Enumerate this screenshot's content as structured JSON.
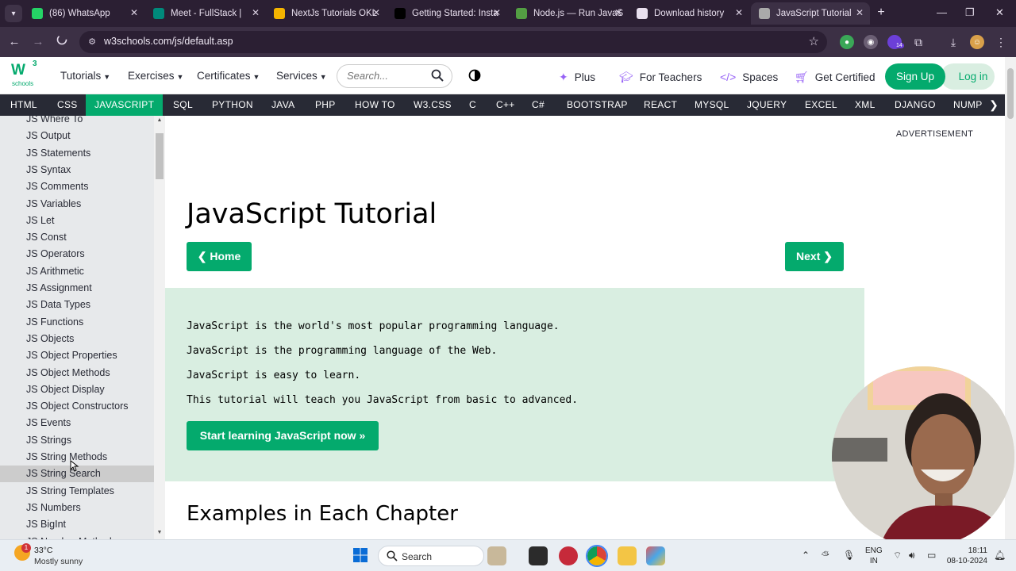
{
  "browser": {
    "tabs": [
      {
        "label": "(86) WhatsApp",
        "icon": "whatsapp-icon",
        "color": "#25d366"
      },
      {
        "label": "Meet - FullStack |",
        "icon": "meet-icon",
        "color": "#00897b"
      },
      {
        "label": "NextJs Tutorials OKL",
        "icon": "slides-icon",
        "color": "#f4b400"
      },
      {
        "label": "Getting Started: Insta",
        "icon": "nextjs-icon",
        "color": "#000000"
      },
      {
        "label": "Node.js — Run JavaS",
        "icon": "nodejs-icon",
        "color": "#539e43"
      },
      {
        "label": "Download history",
        "icon": "download-icon",
        "color": "#e8dfee"
      },
      {
        "label": "JavaScript Tutorial",
        "icon": "loading-icon",
        "color": "#aaaaaa"
      }
    ],
    "url": "w3schools.com/js/default.asp",
    "extension_badge": "14"
  },
  "header": {
    "logo_main": "W",
    "logo_sup": "3",
    "logo_sub": "schools",
    "menus": [
      "Tutorials",
      "Exercises",
      "Certificates",
      "Services"
    ],
    "search_placeholder": "Search...",
    "links": {
      "plus": "Plus",
      "teachers": "For Teachers",
      "spaces": "Spaces",
      "certified": "Get Certified"
    },
    "signup": "Sign Up",
    "login": "Log in"
  },
  "topics": {
    "items": [
      "HTML",
      "CSS",
      "JAVASCRIPT",
      "SQL",
      "PYTHON",
      "JAVA",
      "PHP",
      "HOW TO",
      "W3.CSS",
      "C",
      "C++",
      "C#",
      "BOOTSTRAP",
      "REACT",
      "MYSQL",
      "JQUERY",
      "EXCEL",
      "XML",
      "DJANGO",
      "NUMPY"
    ],
    "active": "JAVASCRIPT"
  },
  "sidebar": {
    "items": [
      "JS Where To",
      "JS Output",
      "JS Statements",
      "JS Syntax",
      "JS Comments",
      "JS Variables",
      "JS Let",
      "JS Const",
      "JS Operators",
      "JS Arithmetic",
      "JS Assignment",
      "JS Data Types",
      "JS Functions",
      "JS Objects",
      "JS Object Properties",
      "JS Object Methods",
      "JS Object Display",
      "JS Object Constructors",
      "JS Events",
      "JS Strings",
      "JS String Methods",
      "JS String Search",
      "JS String Templates",
      "JS Numbers",
      "JS BigInt",
      "JS Number Methods"
    ],
    "hovered": "JS String Search"
  },
  "main": {
    "title": "JavaScript Tutorial",
    "home_button": "❮ Home",
    "next_button": "Next ❯",
    "intro": [
      "JavaScript is the world's most popular programming language.",
      "JavaScript is the programming language of the Web.",
      "JavaScript is easy to learn.",
      "This tutorial will teach you JavaScript from basic to advanced."
    ],
    "start_button": "Start learning JavaScript now »",
    "section_title": "Examples in Each Chapter"
  },
  "ad": {
    "label": "ADVERTISEMENT"
  },
  "taskbar": {
    "temperature": "33°C",
    "condition": "Mostly sunny",
    "weather_badge": "1",
    "search": "Search",
    "lang_top": "ENG",
    "lang_bottom": "IN",
    "time": "18:11",
    "date": "08-10-2024"
  },
  "colors": {
    "brand": "#04aa6d",
    "topicbar": "#282a35",
    "intro_bg": "#d9eee1",
    "sidebar_bg": "#e7e9eb"
  }
}
